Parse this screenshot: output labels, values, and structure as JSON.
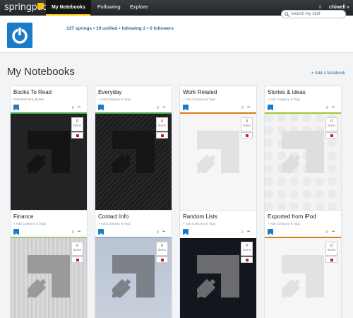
{
  "app": {
    "logo_text": "springpad",
    "accent_color": "#f5c400",
    "brand_blue": "#1a7bc7"
  },
  "nav": {
    "items": [
      {
        "label": "My Notebooks",
        "active": true
      },
      {
        "label": "Following",
        "active": false
      },
      {
        "label": "Explore",
        "active": false
      }
    ],
    "notification_label": "8",
    "user_label": "chiwell"
  },
  "header": {
    "stats": "137 springs • 19 unfiled • following 2 • 0 followers",
    "search_placeholder": "Search my stuff"
  },
  "page": {
    "title": "My Notebooks",
    "add_notebook_label": "+ Add a Notebook"
  },
  "notebooks": [
    {
      "title": "Books To Read",
      "subtitle": "Entertainment_Books",
      "subtitle_is_link": false,
      "count": "0",
      "items_count": "0",
      "items_label": "items",
      "accent": "#4caf50",
      "cover": "dark"
    },
    {
      "title": "Everyday",
      "subtitle": "+ Add Category & Tags",
      "subtitle_is_link": true,
      "count": "0",
      "items_count": "0",
      "items_label": "items",
      "accent": "#4caf50",
      "cover": "dark-stripe"
    },
    {
      "title": "Work Related",
      "subtitle": "+ Add Category & Tags",
      "subtitle_is_link": true,
      "count": "0",
      "items_count": "0",
      "items_label": "items",
      "accent": "#e07b1a",
      "cover": "white"
    },
    {
      "title": "Stories & ideas",
      "subtitle": "+ Add Category & Tags",
      "subtitle_is_link": true,
      "count": "0",
      "items_count": "0",
      "items_label": "items",
      "accent": "#9ccc2c",
      "cover": "damask"
    },
    {
      "title": "Finance",
      "subtitle": "+ Add Category & Tags",
      "subtitle_is_link": true,
      "count": "0",
      "items_count": "0",
      "items_label": "items",
      "accent": "#a0c878",
      "cover": "wood"
    },
    {
      "title": "Contact Info",
      "subtitle": "+ Add Category & Tags",
      "subtitle_is_link": true,
      "count": "0",
      "items_count": "0",
      "items_label": "items",
      "accent": "#9fb0c8",
      "cover": "blue-gray"
    },
    {
      "title": "Random Lists",
      "subtitle": "+ Add Category & Tags",
      "subtitle_is_link": true,
      "count": "0",
      "items_count": "0",
      "items_label": "items",
      "accent": "#ffffff",
      "cover": "dark-navy"
    },
    {
      "title": "Exported from iPod",
      "subtitle": "+ Add Category & Tags",
      "subtitle_is_link": true,
      "count": "0",
      "items_count": "0",
      "items_label": "items",
      "accent": "#e07b1a",
      "cover": "white"
    }
  ],
  "icons": {
    "avatar": "power-icon",
    "search": "search-icon",
    "lock": "lock-icon",
    "menu": "more-icon"
  }
}
